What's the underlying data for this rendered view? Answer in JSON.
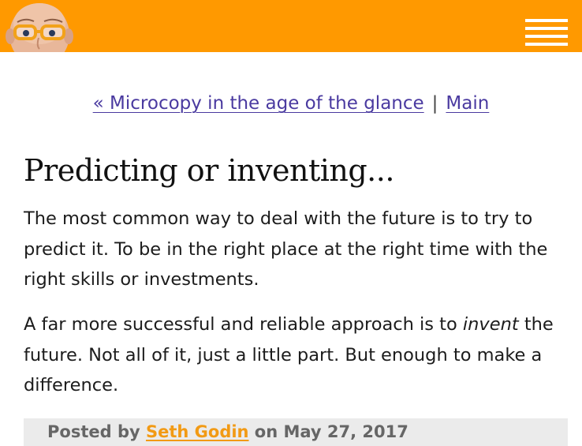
{
  "header": {
    "background_color": "#ff9900",
    "menu_icon": "hamburger-menu-icon",
    "avatar": "author-photo"
  },
  "nav": {
    "prev_link": "« Microcopy in the age of the glance",
    "separator": "|",
    "main_link": "Main"
  },
  "post": {
    "title": "Predicting or inventing...",
    "paragraph1": "The most common way to deal with the future is to try to predict it. To be in the right place at the right time with the right skills or investments.",
    "paragraph2_before": "A far more successful and reliable approach is to ",
    "paragraph2_emphasis": "invent",
    "paragraph2_after": " the future. Not all of it, just a little part. But enough to make a difference."
  },
  "footer": {
    "posted_by_label": "Posted by ",
    "author": "Seth Godin",
    "on_label": " on ",
    "date": "May 27, 2017",
    "author_color": "#f29a14"
  }
}
